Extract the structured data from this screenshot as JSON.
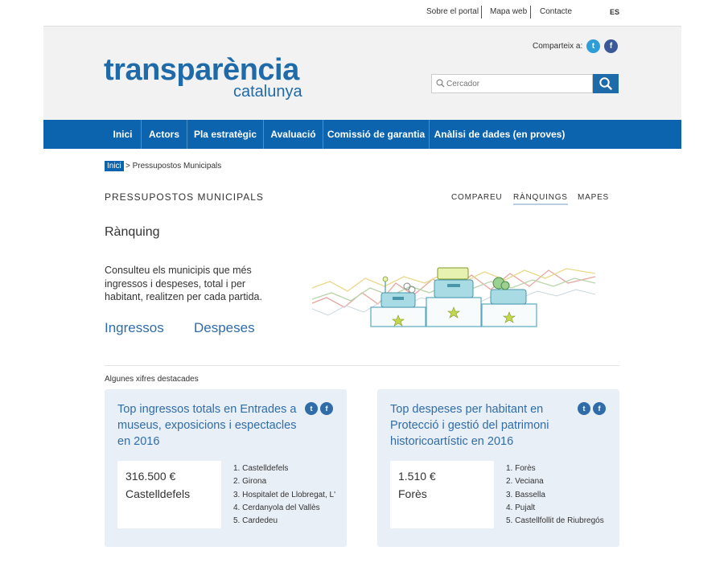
{
  "topbar": {
    "links": [
      "Sobre el portal",
      "Mapa web",
      "Contacte"
    ],
    "lang": "ES"
  },
  "header": {
    "logo_main": "transparència",
    "logo_sub": "catalunya",
    "share_label": "Comparteix a:",
    "search_placeholder": "Cercador"
  },
  "nav": {
    "items": [
      "Inici",
      "Actors",
      "Pla estratègic",
      "Avaluació",
      "Comissió de garantia",
      "Anàlisi de dades (en proves)"
    ]
  },
  "breadcrumb": {
    "home": "Inici",
    "current": "> Pressupostos Municipals"
  },
  "page": {
    "heading": "PRESSUPOSTOS MUNICIPALS",
    "subnav": [
      "COMPAREU",
      "RÀNQUINGS",
      "MAPES"
    ],
    "active_subnav": "RÀNQUINGS",
    "title": "Rànquing",
    "intro": "Consulteu els municipis que més ingressos i despeses, total i per habitant, realitzen per cada partida.",
    "link_income": "Ingressos",
    "link_expense": "Despeses",
    "section_label": "Algunes xifres destacades"
  },
  "cards": [
    {
      "title": "Top ingressos totals en Entrades a museus, exposicions i espectacles en 2016",
      "value": "316.500 €",
      "place": "Castelldefels",
      "ranking": [
        "1. Castelldefels",
        "2. Girona",
        "3. Hospitalet de Llobregat, L'",
        "4. Cerdanyola del Vallès",
        "5. Cardedeu"
      ]
    },
    {
      "title": "Top despeses per habitant en Protecció i gestió del patrimoni historicoartístic en 2016",
      "value": "1.510 €",
      "place": "Forès",
      "ranking": [
        "1. Forès",
        "2. Veciana",
        "3. Bassella",
        "4. Pujalt",
        "5. Castellfollit de Riubregós"
      ]
    }
  ],
  "colors": {
    "brand_blue": "#0b64ad",
    "link_blue": "#2f6ca8",
    "twitter": "#2f9ed8",
    "facebook": "#3b5998",
    "card_bg": "#e9eff6"
  },
  "icons": {
    "search": "search-icon",
    "twitter": "twitter-icon",
    "facebook": "facebook-icon"
  }
}
